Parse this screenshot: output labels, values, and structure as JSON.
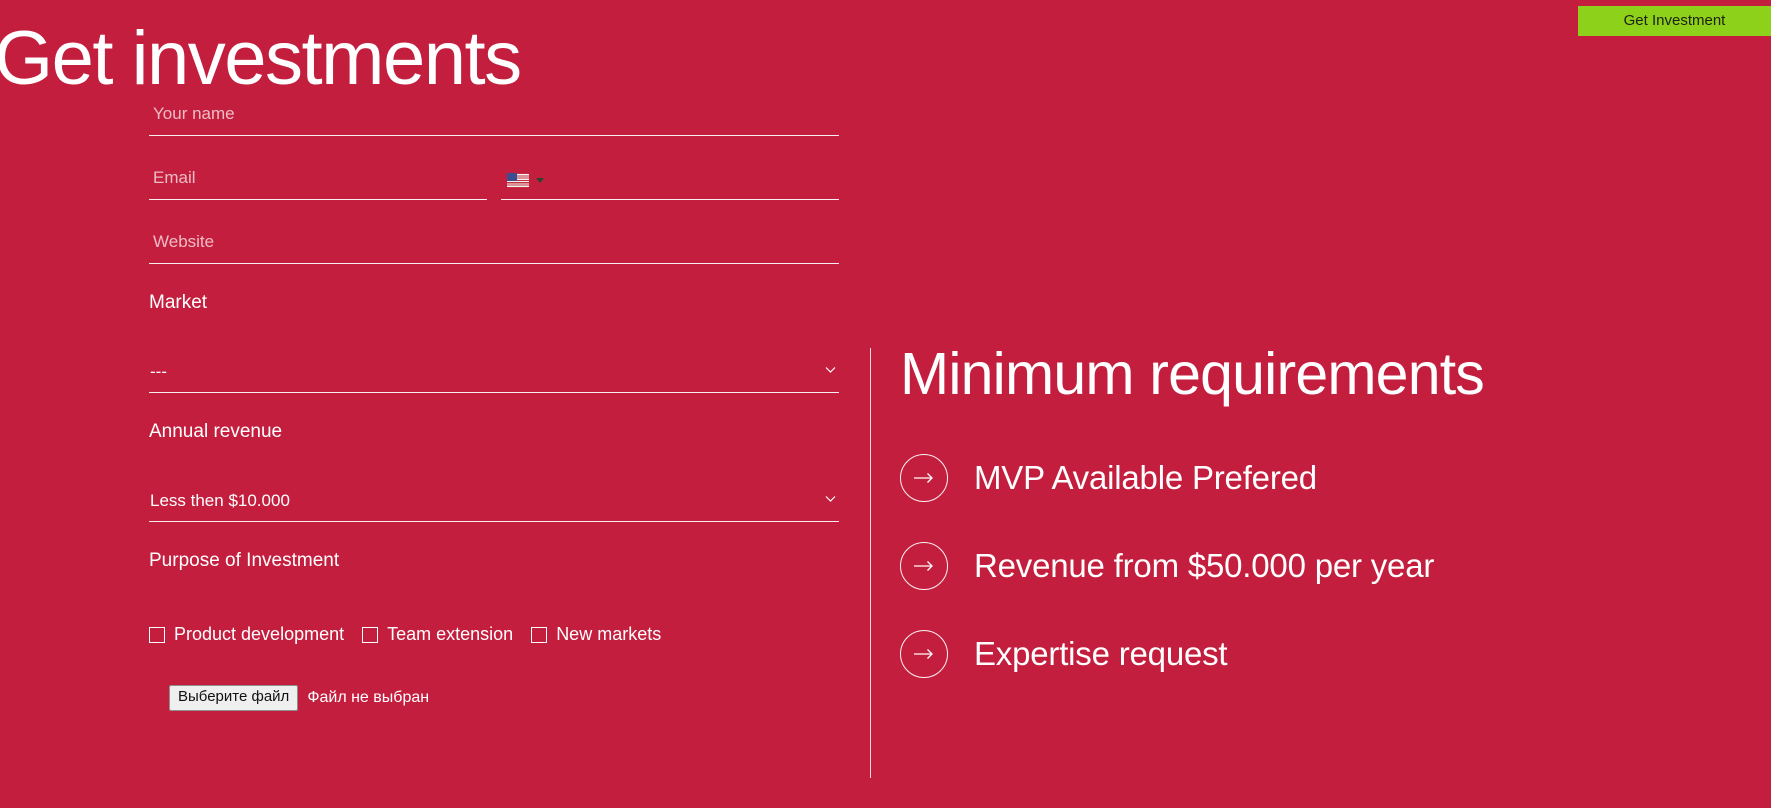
{
  "page": {
    "title": "Get investments",
    "background_color": "#C41E3E"
  },
  "header": {
    "cta_label": "Get Investment",
    "cta_color": "#8DD11A"
  },
  "form": {
    "name_field": {
      "placeholder": "Your name",
      "value": ""
    },
    "email_field": {
      "placeholder": "Email",
      "value": ""
    },
    "phone_field": {
      "placeholder": "",
      "value": "",
      "country_flag": "us-flag-icon"
    },
    "website_field": {
      "placeholder": "Website",
      "value": ""
    },
    "market": {
      "label": "Market",
      "value": "---",
      "options": [
        "---"
      ]
    },
    "annual_revenue": {
      "label": "Annual revenue",
      "value": "Less then $10.000",
      "options": [
        "Less then $10.000"
      ]
    },
    "purpose": {
      "label": "Purpose of Investment",
      "checkboxes": [
        {
          "label": "Product development",
          "checked": false
        },
        {
          "label": "Team extension",
          "checked": false
        },
        {
          "label": "New markets",
          "checked": false
        }
      ]
    },
    "file_upload": {
      "button_label": "Выберите файл",
      "status_text": "Файл не выбран"
    }
  },
  "requirements": {
    "title": "Minimum requirements",
    "items": [
      {
        "icon": "arrow-right-icon",
        "text": "MVP Available Prefered"
      },
      {
        "icon": "arrow-right-icon",
        "text": "Revenue from $50.000 per year"
      },
      {
        "icon": "arrow-right-icon",
        "text": "Expertise request"
      }
    ]
  }
}
